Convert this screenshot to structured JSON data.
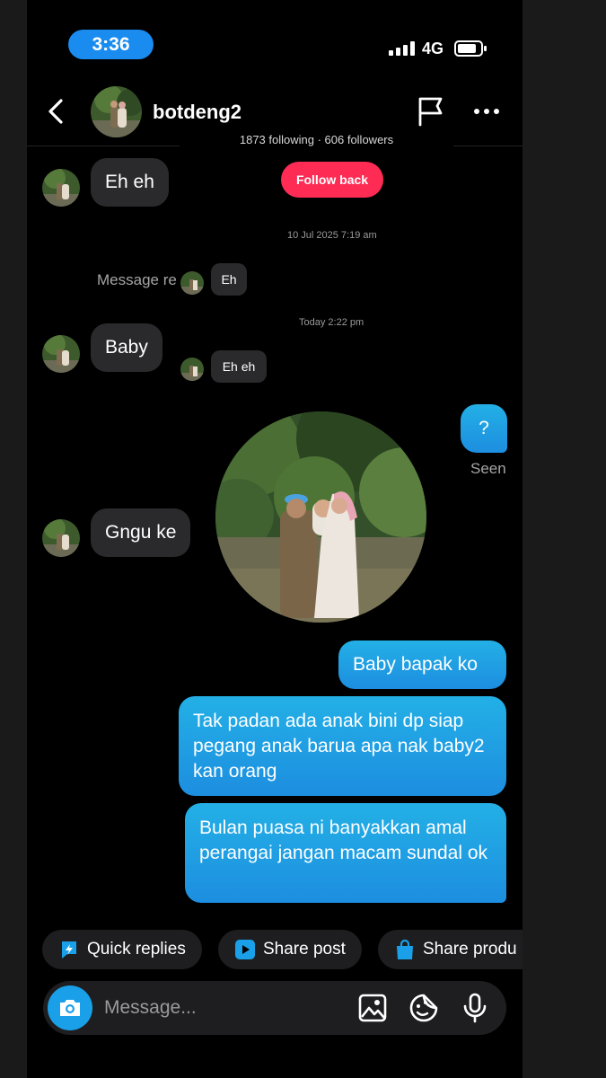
{
  "status_bar": {
    "time": "3:36",
    "network": "4G"
  },
  "header": {
    "username": "botdeng2",
    "stats": "1873 following · 606 followers",
    "follow_label": "Follow back"
  },
  "timestamps": {
    "first": "10 Jul 2025 7:19 am",
    "second": "Today 2:22 pm"
  },
  "messages": {
    "in_1": "Eh eh",
    "request_label": "Message re",
    "reply_1": "Eh",
    "in_2": "Baby",
    "reply_2": "Eh eh",
    "out_q": "?",
    "seen": "Seen",
    "in_3": "Gngu ke",
    "out_1": "Baby bapak ko",
    "out_2": "Tak padan ada anak bini dp siap pegang anak barua apa nak baby2 kan orang",
    "out_3": "Bulan puasa ni banyakkan amal perangai jangan macam sundal ok"
  },
  "quick_chips": [
    {
      "label": "Quick replies",
      "icon": "bolt-icon"
    },
    {
      "label": "Share post",
      "icon": "play-icon"
    },
    {
      "label": "Share produ",
      "icon": "shopping-bag-icon"
    }
  ],
  "composer": {
    "placeholder": "Message..."
  },
  "colors": {
    "accent_blue": "#1d9be3",
    "follow_red": "#fe2c55",
    "bubble_gray": "#2a2a2c"
  }
}
